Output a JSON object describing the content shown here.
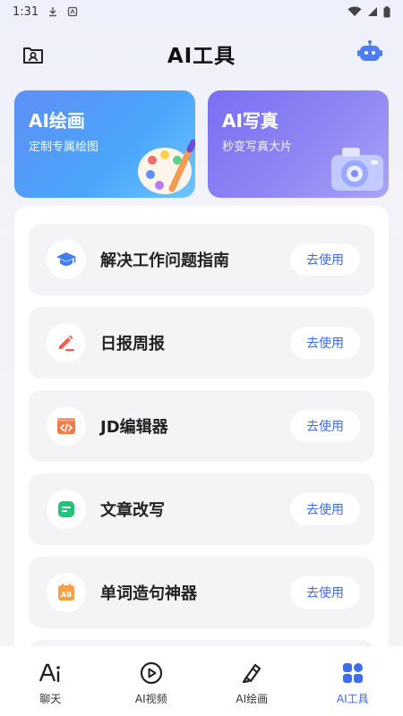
{
  "status_bar": {
    "time": "1:31"
  },
  "header": {
    "title": "AI工具"
  },
  "feature_cards": [
    {
      "title": "AI绘画",
      "subtitle": "定制专属绘图"
    },
    {
      "title": "AI写真",
      "subtitle": "秒变写真大片"
    }
  ],
  "tools": [
    {
      "name": "解决工作问题指南",
      "button": "去使用",
      "icon": "graduation-cap-icon"
    },
    {
      "name": "日报周报",
      "button": "去使用",
      "icon": "edit-pen-icon"
    },
    {
      "name": "JD编辑器",
      "button": "去使用",
      "icon": "code-window-icon"
    },
    {
      "name": "文章改写",
      "button": "去使用",
      "icon": "text-document-icon"
    },
    {
      "name": "单词造句神器",
      "button": "去使用",
      "icon": "ab-calendar-icon"
    }
  ],
  "tabbar": {
    "items": [
      {
        "label": "聊天",
        "icon": "ai-chat-icon"
      },
      {
        "label": "AI视频",
        "icon": "play-circle-icon"
      },
      {
        "label": "AI绘画",
        "icon": "brush-icon"
      },
      {
        "label": "AI工具",
        "icon": "grid-apps-icon"
      }
    ],
    "active_index": 3
  },
  "colors": {
    "accent": "#3d6cf0",
    "paint_card": "#4f9cf9",
    "photo_card": "#8a82f4"
  }
}
